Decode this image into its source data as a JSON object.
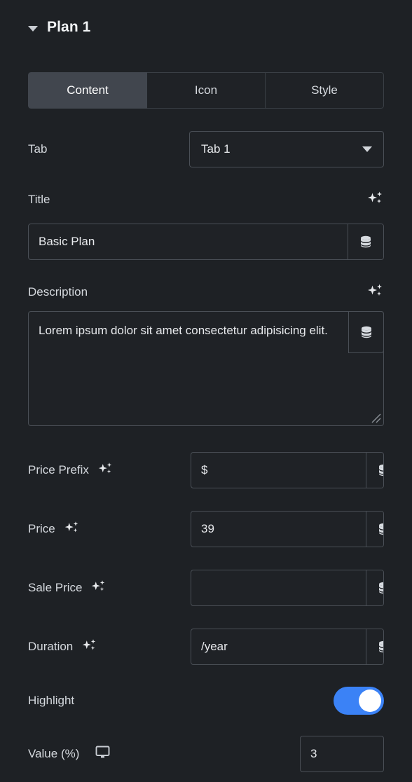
{
  "panel": {
    "section_title": "Plan 1",
    "collapse_icon": "caret-down-icon"
  },
  "tabs": [
    {
      "label": "Content",
      "active": true
    },
    {
      "label": "Icon",
      "active": false
    },
    {
      "label": "Style",
      "active": false
    }
  ],
  "fields": {
    "tab": {
      "label": "Tab",
      "value": "Tab 1",
      "caret_icon": "chevron-down-icon"
    },
    "title": {
      "label": "Title",
      "value": "Basic Plan",
      "placeholder": "",
      "ai_icon": "sparkles-icon",
      "tag_icon": "database-icon"
    },
    "description": {
      "label": "Description",
      "value": "Lorem ipsum dolor sit amet consectetur adipisicing elit.",
      "placeholder": "",
      "ai_icon": "sparkles-icon",
      "tag_icon": "database-icon",
      "resize_icon": "resize-grip-icon"
    },
    "price_prefix": {
      "label": "Price Prefix",
      "value": "$",
      "placeholder": "",
      "ai_icon": "sparkles-icon",
      "tag_icon": "database-icon"
    },
    "price": {
      "label": "Price",
      "value": "39",
      "placeholder": "",
      "ai_icon": "sparkles-icon",
      "tag_icon": "database-icon"
    },
    "sale_price": {
      "label": "Sale Price",
      "value": "",
      "placeholder": "",
      "ai_icon": "sparkles-icon",
      "tag_icon": "database-icon"
    },
    "duration": {
      "label": "Duration",
      "value": "/year",
      "placeholder": "",
      "ai_icon": "sparkles-icon",
      "tag_icon": "database-icon"
    },
    "highlight": {
      "label": "Highlight",
      "state": "on"
    },
    "value_percent": {
      "label": "Value (%)",
      "value": "3",
      "placeholder": "",
      "device_icon": "desktop-monitor-icon"
    }
  },
  "colors": {
    "background": "#1e2125",
    "field_background": "#1f2226",
    "border": "#4a4f56",
    "tab_active_background": "#41464e",
    "toggle_on": "#3b82f6",
    "text": "#d5d9de"
  }
}
